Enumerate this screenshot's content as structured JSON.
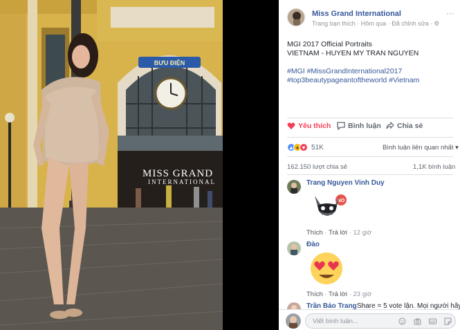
{
  "photo": {
    "watermark_line1": "MISS GRAND",
    "watermark_line2": "INTERNATIONAL",
    "sign_text": "BƯU ĐIỆN"
  },
  "post": {
    "page_name": "Miss Grand International",
    "meta": "Trang bạn thích · Hôm qua · Đã chỉnh sửa · ",
    "more": "···",
    "text_lines": [
      "MGI 2017 Official Portraits",
      "VIETNAM - HUYEN MY TRAN NGUYEN"
    ],
    "hashtags": [
      "#MGI #MissGrandInternational2017",
      "#top3beautypageantoftheworld #Vietnam"
    ]
  },
  "actions": {
    "like": "Yêu thích",
    "comment": "Bình luận",
    "share": "Chia sẻ"
  },
  "reactions": {
    "count": "51K",
    "sort_label": "Bình luận liên quan nhất",
    "shares": "162.150 lượt chia sẻ",
    "comments": "1,1K bình luận"
  },
  "comments": [
    {
      "name": "Trang Nguyen Vinh Duy",
      "text": "",
      "like": "Thích",
      "reply": "Trả lời",
      "time": "12 giờ",
      "sticker": "raccoon-sticker"
    },
    {
      "name": "Đào",
      "text": "",
      "like": "Thích",
      "reply": "Trả lời",
      "time": "23 giờ",
      "sticker": "heart-eyes-emoji"
    },
    {
      "name": "Trần Bảo Trang",
      "text": "Share = 5 vote lận. Mọi người hãy"
    }
  ],
  "input": {
    "placeholder": "Viết bình luận..."
  },
  "colors": {
    "link": "#365899",
    "like_active": "#f33e58",
    "text": "#1d2129",
    "muted": "#90949c"
  }
}
